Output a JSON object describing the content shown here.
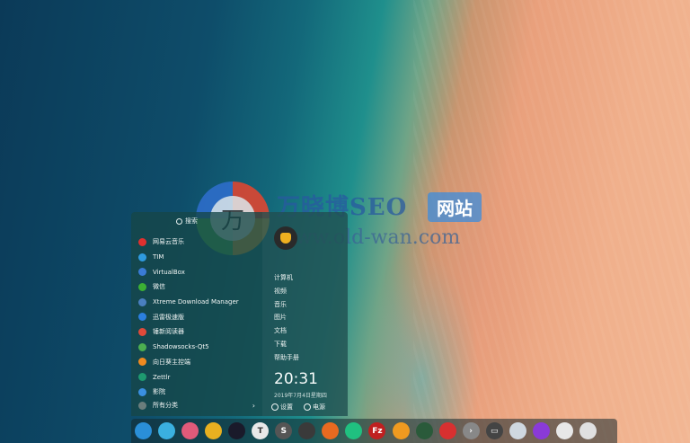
{
  "launcher": {
    "search_placeholder": "搜索",
    "apps": [
      {
        "label": "网易云音乐",
        "color": "#e0302f"
      },
      {
        "label": "TIM",
        "color": "#2f9be0"
      },
      {
        "label": "VirtualBox",
        "color": "#3a7bd5"
      },
      {
        "label": "微信",
        "color": "#3cb034"
      },
      {
        "label": "Xtreme Download Manager",
        "color": "#4a7fc0"
      },
      {
        "label": "迅雷极速版",
        "color": "#2b7fe0"
      },
      {
        "label": "锤新阅读器",
        "color": "#e04a3a"
      },
      {
        "label": "Shadowsocks-Qt5",
        "color": "#4caf50"
      },
      {
        "label": "向日葵主控端",
        "color": "#f08a20"
      },
      {
        "label": "Zettlr",
        "color": "#1e9a70"
      },
      {
        "label": "影院",
        "color": "#3a8fe0"
      }
    ],
    "all_categories": "所有分类",
    "places": [
      "计算机",
      "视频",
      "音乐",
      "图片",
      "文档",
      "下载",
      "帮助手册"
    ],
    "time": "20:31",
    "date": "2019年7月4日星期四",
    "settings_label": "设置",
    "power_label": "电源"
  },
  "watermark": {
    "logo_char": "万",
    "title": "万晓博SEO",
    "badge": "网站",
    "url": "www.old-wan.com"
  },
  "dock": {
    "icons": [
      {
        "name": "launcher-icon",
        "color": "#2a8fd8",
        "glyph": ""
      },
      {
        "name": "file-manager-icon",
        "color": "#3ab0e0",
        "glyph": ""
      },
      {
        "name": "store-icon",
        "color": "#e05a7a",
        "glyph": ""
      },
      {
        "name": "chrome-icon",
        "color": "#e8b020",
        "glyph": ""
      },
      {
        "name": "jetbrains-icon",
        "color": "#1a1a2a",
        "glyph": ""
      },
      {
        "name": "typora-icon",
        "color": "#e8e8e8",
        "glyph": "T"
      },
      {
        "name": "sublime-icon",
        "color": "#555555",
        "glyph": "S"
      },
      {
        "name": "inkscape-icon",
        "color": "#3a3a3a",
        "glyph": ""
      },
      {
        "name": "brush-icon",
        "color": "#e86a20",
        "glyph": ""
      },
      {
        "name": "send-icon",
        "color": "#20c080",
        "glyph": ""
      },
      {
        "name": "filezilla-icon",
        "color": "#c02020",
        "glyph": "Fz"
      },
      {
        "name": "sunflower-icon",
        "color": "#f09a20",
        "glyph": ""
      },
      {
        "name": "activity-icon",
        "color": "#2a5a3a",
        "glyph": ""
      },
      {
        "name": "netease-music-icon",
        "color": "#d83030",
        "glyph": ""
      },
      {
        "name": "terminal-icon",
        "color": "#888888",
        "glyph": "›"
      },
      {
        "name": "deepin-terminal-icon",
        "color": "#444444",
        "glyph": "▭"
      },
      {
        "name": "weather-icon",
        "color": "#cfd8e0",
        "glyph": ""
      },
      {
        "name": "power-icon",
        "color": "#8a3ad8",
        "glyph": ""
      },
      {
        "name": "qq-icon",
        "color": "#e8e8e8",
        "glyph": ""
      },
      {
        "name": "trash-icon",
        "color": "#e0e0e0",
        "glyph": ""
      }
    ]
  }
}
